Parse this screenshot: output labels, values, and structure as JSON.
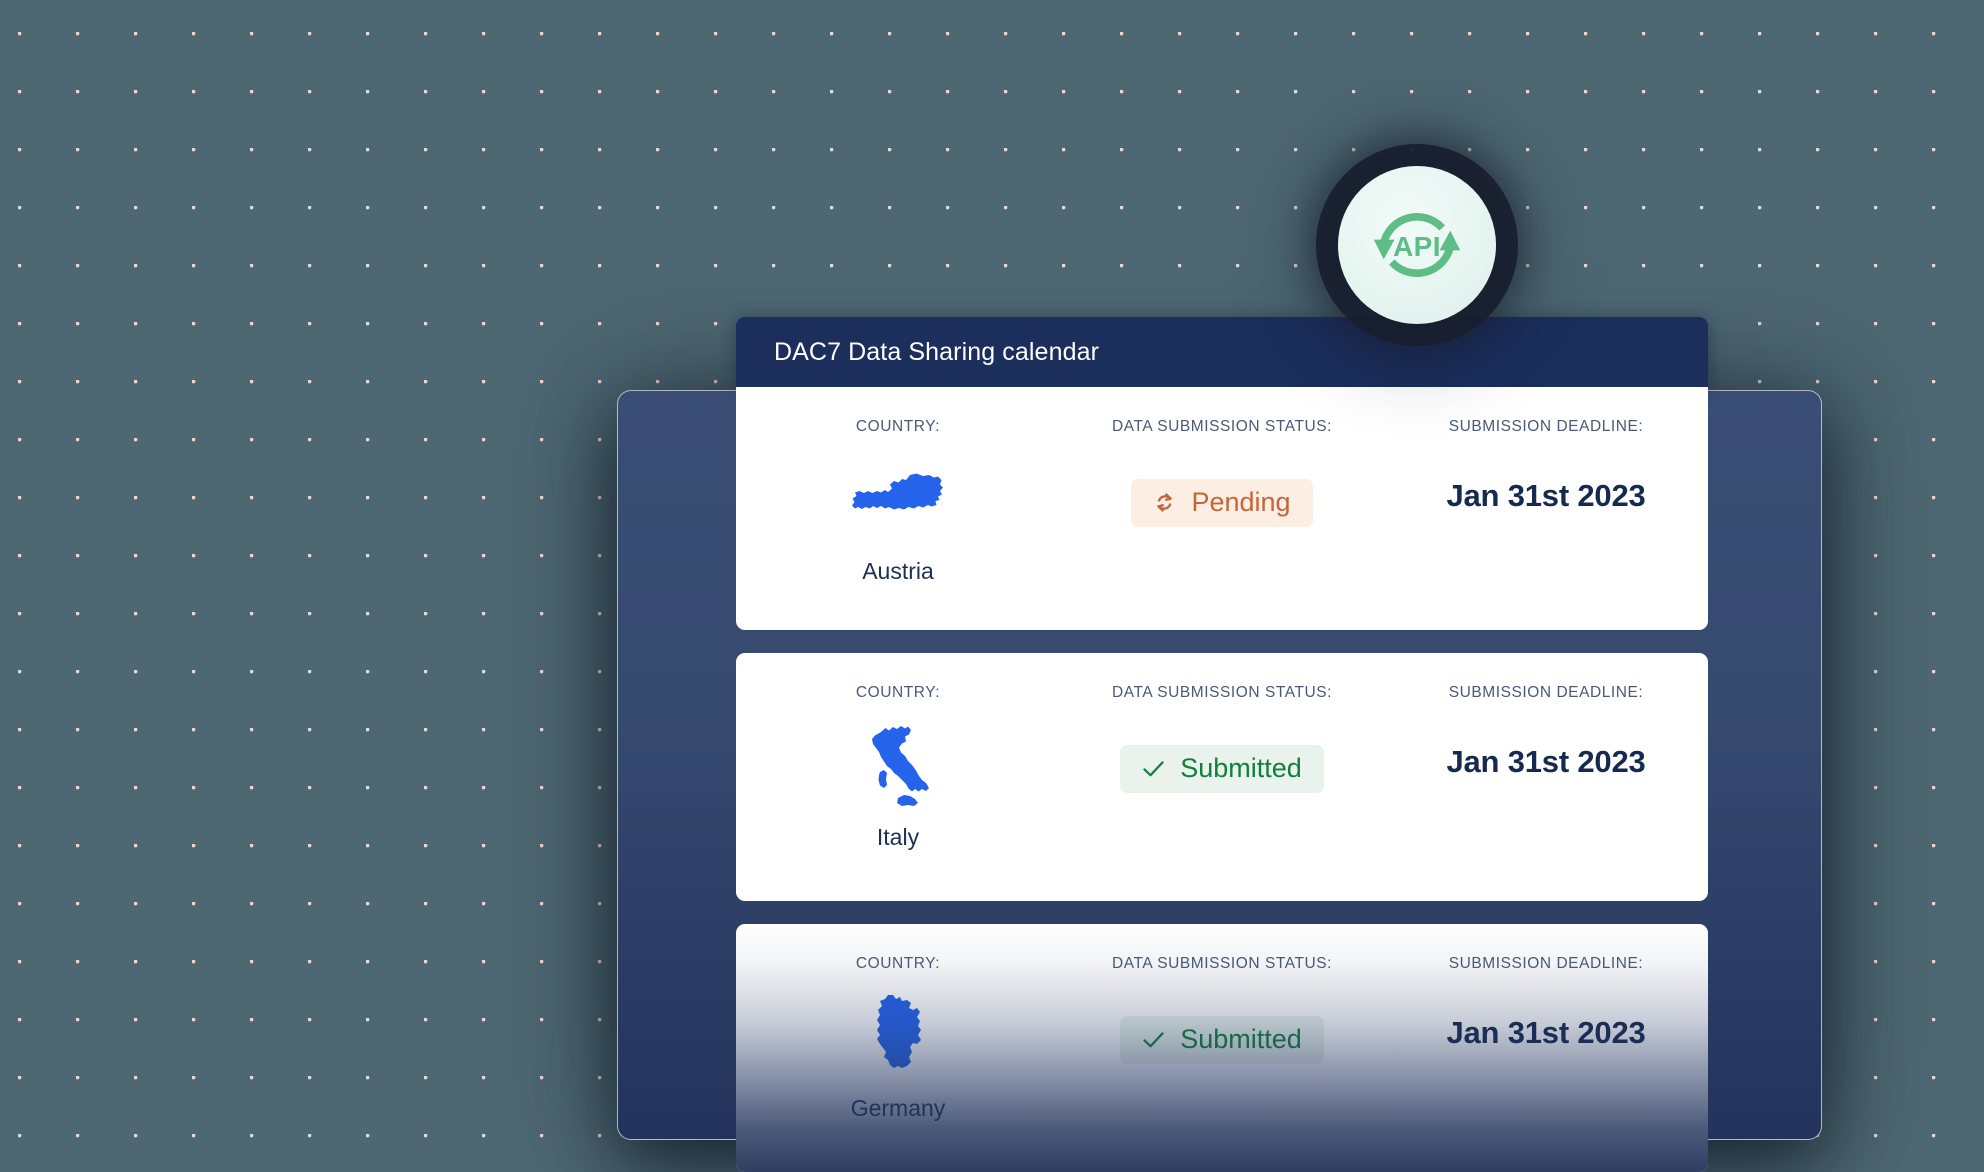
{
  "header": {
    "title": "DAC7 Data Sharing calendar"
  },
  "columns": {
    "country": "COUNTRY:",
    "status": "DATA SUBMISSION STATUS:",
    "deadline": "SUBMISSION DEADLINE:"
  },
  "badge_icons": {
    "pending": "sync-icon",
    "submitted": "check-icon"
  },
  "colors": {
    "header_bg": "#1b2e5c",
    "back_card": "#36496f",
    "page_bg": "#4e6873",
    "dot": "#f2d9d4",
    "map_blue": "#2563eb",
    "pending_text": "#c4663a",
    "pending_bg": "#fdeee3",
    "submitted_text": "#12803d",
    "submitted_bg": "#e9f3ec",
    "deadline_text": "#16294f",
    "api_green": "#5ebd86"
  },
  "api_badge": {
    "label": "API",
    "icon": "api-sync-icon"
  },
  "rows": [
    {
      "country": "Austria",
      "map": "austria-map-icon",
      "status": "Pending",
      "status_type": "pending",
      "deadline": "Jan 31st 2023"
    },
    {
      "country": "Italy",
      "map": "italy-map-icon",
      "status": "Submitted",
      "status_type": "submitted",
      "deadline": "Jan 31st 2023"
    },
    {
      "country": "Germany",
      "map": "germany-map-icon",
      "status": "Submitted",
      "status_type": "submitted",
      "deadline": "Jan 31st 2023"
    }
  ]
}
